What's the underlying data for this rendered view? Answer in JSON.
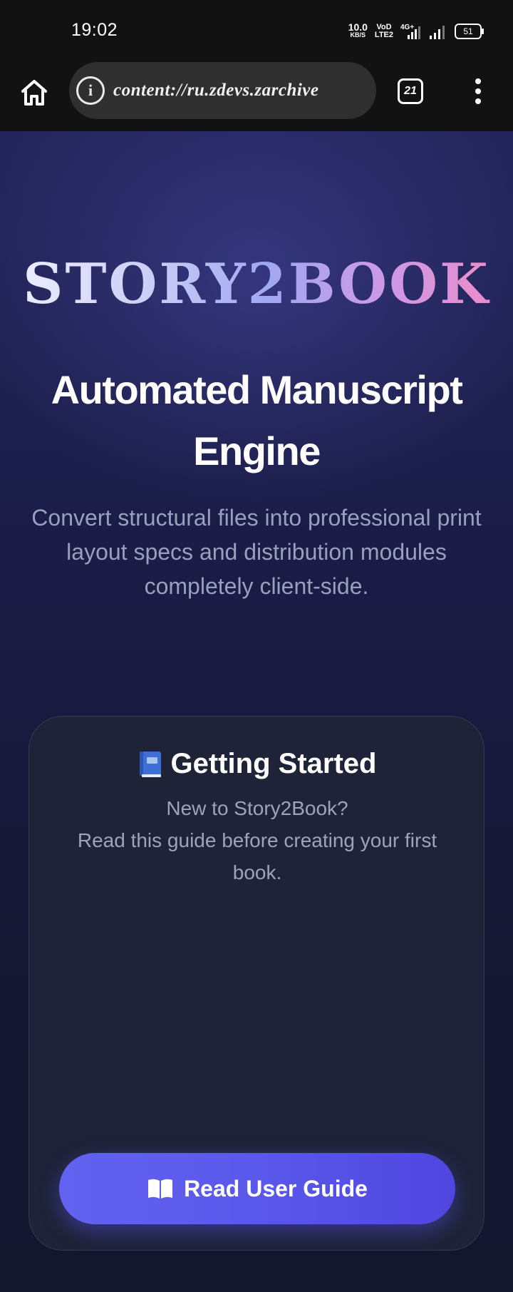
{
  "status_bar": {
    "time": "19:02",
    "net_speed_value": "10.0",
    "net_speed_unit": "KB/S",
    "volte_top": "VoD",
    "volte_bottom": "LTE2",
    "network_type": "4G+",
    "battery_level": "51"
  },
  "browser": {
    "url": "content://ru.zdevs.zarchive",
    "info_glyph": "i",
    "tab_count": "21",
    "icons": {
      "home": "home-icon",
      "info": "info-icon",
      "menu": "more-vertical-icon"
    }
  },
  "hero": {
    "logo": "STORY2BOOK",
    "headline": "Automated Manuscript Engine",
    "subtext": "Convert structural files into professional print layout specs and distribution modules completely client-side."
  },
  "card": {
    "title": "Getting Started",
    "desc_line1": "New to Story2Book?",
    "desc_line2": "Read this guide before creating your first book.",
    "button_label": "Read User Guide",
    "icons": {
      "title": "blue-book-icon",
      "button": "open-book-icon"
    }
  },
  "colors": {
    "accent": "#5a58ea",
    "logo_gradient_start": "#f2f2ff",
    "logo_gradient_end": "#f08ac6"
  }
}
